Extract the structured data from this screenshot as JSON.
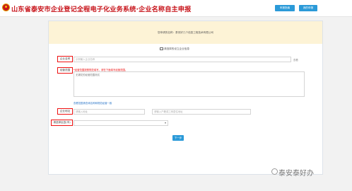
{
  "header": {
    "title": "山东省泰安市企业登记全程电子化业务系统·企业名称自主申报",
    "buttons": [
      {
        "label": "申报指南"
      },
      {
        "label": "我的申报"
      }
    ]
  },
  "notice": {
    "text": "您申请的名称：泰安好几个信息工程技术有限公司"
  },
  "enterprise_link": {
    "label": "请选择的设立企业信息"
  },
  "form": {
    "enterprise_name": {
      "label": "企业名称",
      "placeholder": "示例输入企业名称",
      "suffix": "查看"
    },
    "business_scope": {
      "label": "经营范围",
      "hint_red": "*经营范围按照规范填写，请在下面填写经营范围。",
      "value": "无锡花的经营范围测试",
      "below_hint": "查看范围请查询名称和规范经营一致"
    },
    "contact": {
      "label": "企业地址",
      "field1_placeholder": "请输入地址",
      "field2_placeholder": "请输入户籍或工商居住地址"
    },
    "region": {
      "label": "请选择区县(市)",
      "value": ""
    },
    "next_button": "下一步"
  },
  "watermark": {
    "text": "泰安泰好办"
  },
  "colors": {
    "brand_red": "#c8161d",
    "accent_blue": "#2b9ad8",
    "notice_bg": "#fdf3d6",
    "error_red": "#e11111"
  }
}
